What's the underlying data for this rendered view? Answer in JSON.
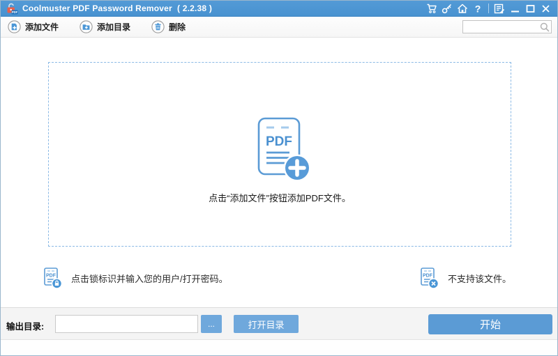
{
  "titlebar": {
    "title": "Coolmuster PDF Password Remover  ( 2.2.38 )",
    "icons": [
      "cart-icon",
      "key-icon",
      "home-icon",
      "help-icon",
      "feedback-icon",
      "minimize-icon",
      "maximize-icon",
      "close-icon"
    ]
  },
  "toolbar": {
    "buttons": [
      {
        "label": "添加文件",
        "icon": "add-file-icon"
      },
      {
        "label": "添加目录",
        "icon": "add-folder-icon"
      },
      {
        "label": "删除",
        "icon": "delete-icon"
      }
    ],
    "search": {
      "value": "",
      "placeholder": "",
      "icon": "search-icon"
    }
  },
  "dropzone": {
    "pdf_label": "PDF",
    "hint_text": "点击“添加文件”按钮添加PDF文件。"
  },
  "hints": {
    "pdf_small_label": "PDF",
    "lock_hint": "点击锁标识并输入您的用户/打开密码。",
    "unsupported_hint": "不支持该文件。"
  },
  "footer": {
    "output_dir_label": "输出目录:",
    "output_dir_value": "",
    "browse_label": "...",
    "open_dir_label": "打开目录",
    "start_label": "开始"
  },
  "colors": {
    "titlebar_blue": "#4b95d3",
    "accent_blue": "#5b9bd5",
    "light_button_blue": "#6fa8dc",
    "dashed_border_blue": "#8ab9e5",
    "lock_icon_red": "#e8604c"
  }
}
